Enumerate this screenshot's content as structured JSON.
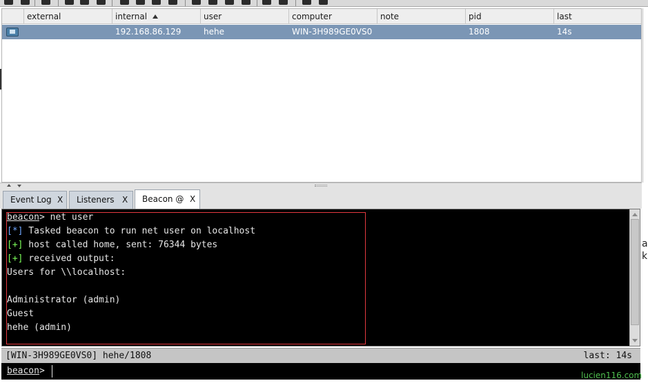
{
  "table": {
    "columns": [
      {
        "label": "",
        "name": "col-icon"
      },
      {
        "label": "external",
        "name": "col-external"
      },
      {
        "label": "internal",
        "name": "col-internal"
      },
      {
        "label": "user",
        "name": "col-user"
      },
      {
        "label": "computer",
        "name": "col-computer"
      },
      {
        "label": "note",
        "name": "col-note"
      },
      {
        "label": "pid",
        "name": "col-pid"
      },
      {
        "label": "last",
        "name": "col-last"
      }
    ],
    "rows": [
      {
        "icon": "windows-host-icon",
        "external": "",
        "internal": "192.168.86.129",
        "user": "hehe",
        "computer": "WIN-3H989GE0VS0",
        "note": "",
        "pid": "1808",
        "last": "14s"
      }
    ],
    "sorted_by": "internal"
  },
  "tabs": [
    {
      "label": "Event Log",
      "close": "X"
    },
    {
      "label": "Listeners",
      "close": "X"
    },
    {
      "label": "Beacon @",
      "close": "X",
      "active": true
    }
  ],
  "console": {
    "prompt_word": "beacon",
    "lines": [
      {
        "type": "prompt",
        "text": "> net user"
      },
      {
        "type": "info",
        "marker": "[*]",
        "text": " Tasked beacon to run net user on localhost"
      },
      {
        "type": "ok",
        "marker": "[+]",
        "text": " host called home, sent: 76344 bytes"
      },
      {
        "type": "ok",
        "marker": "[+]",
        "text": " received output:"
      },
      {
        "type": "plain",
        "text": "Users for \\\\localhost:"
      },
      {
        "type": "plain",
        "text": ""
      },
      {
        "type": "plain",
        "text": "Administrator (admin)"
      },
      {
        "type": "plain",
        "text": "Guest"
      },
      {
        "type": "plain",
        "text": "hehe (admin)"
      }
    ]
  },
  "statusbar": {
    "left": "[WIN-3H989GE0VS0] hehe/1808",
    "right": "last: 14s"
  },
  "input": {
    "prompt_word": "beacon",
    "prompt_suffix": ">",
    "value": ""
  },
  "edge_text": [
    "a",
    "k"
  ],
  "watermark": "lucien116.com",
  "colors": {
    "selected_row": "#7b96b5",
    "console_bg": "#000000",
    "info_marker": "#6fa7ff",
    "ok_marker": "#7cff5a",
    "highlight_box": "#e5393f"
  }
}
